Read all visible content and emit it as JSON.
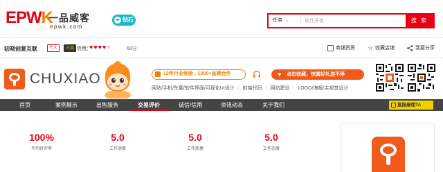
{
  "site": {
    "logo_epwk_prefix": "EPW",
    "logo_epwk_k": "K",
    "logo_cn": "一品威客",
    "logo_url": "epwk.com",
    "diamond_badge": "钻石"
  },
  "search": {
    "category": "任务",
    "placeholder": "软件开发",
    "button_label": "搜 索"
  },
  "shop": {
    "name": "初晓创意互联",
    "type_badge": "个人",
    "level_badge": "三品",
    "credit_label": "信用：",
    "hearts_filled": 4,
    "hearts_total": 5,
    "score": "68分",
    "actions": [
      {
        "label": "商铺资质",
        "icon": "certificate-icon"
      },
      {
        "label": "收藏店铺",
        "icon": "star-icon"
      },
      {
        "label": "我要分享",
        "icon": "share-icon"
      }
    ]
  },
  "banner": {
    "brand_word": "CHUXIAO",
    "promo_text": "12年行业经验，1000+品牌合作",
    "collect_text": "点击收藏，惊喜好礼送不停",
    "service_links": [
      "网站/手机/车载/软件界面/可视化UI设计",
      "前端代码",
      "网站建设",
      "LOGO/海报/主视觉设计"
    ]
  },
  "nav": {
    "items": [
      "首页",
      "案例展示",
      "出售服务",
      "交易评价",
      "诚信/信用",
      "资讯动态",
      "关于我们"
    ],
    "active_index": 3,
    "cta_label": "直接雇佣TA"
  },
  "stats": [
    {
      "value": "100%",
      "label": "平均好评率"
    },
    {
      "value": "5.0",
      "label": "工作速度"
    },
    {
      "value": "5.0",
      "label": "工作质量"
    },
    {
      "value": "5.0",
      "label": "工作态度"
    }
  ],
  "colors": {
    "brand_red": "#e60012",
    "brand_orange": "#f05a1a",
    "nav_bg": "#444444",
    "cta_yellow": "#f5d000"
  }
}
